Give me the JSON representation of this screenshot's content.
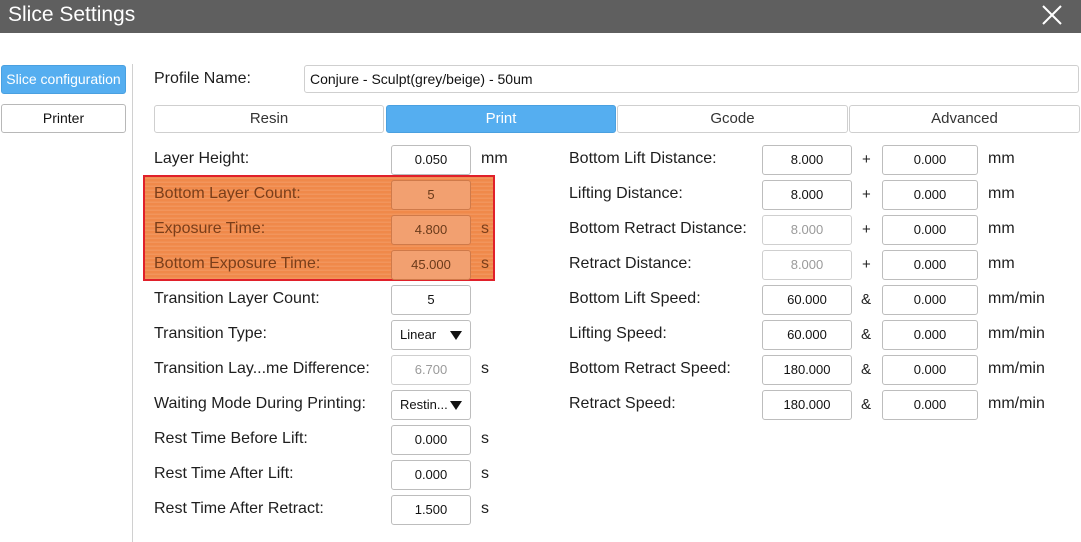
{
  "window": {
    "title": "Slice Settings"
  },
  "sidebar": {
    "items": [
      {
        "label": "Slice configuration"
      },
      {
        "label": "Printer"
      }
    ]
  },
  "profile": {
    "label": "Profile Name:",
    "value": "Conjure - Sculpt(grey/beige) - 50um"
  },
  "tabs": [
    {
      "label": "Resin"
    },
    {
      "label": "Print"
    },
    {
      "label": "Gcode"
    },
    {
      "label": "Advanced"
    }
  ],
  "left_settings": [
    {
      "label": "Layer Height:",
      "value": "0.050",
      "unit": "mm"
    },
    {
      "label": "Bottom Layer Count:",
      "value": "5",
      "unit": ""
    },
    {
      "label": "Exposure Time:",
      "value": "4.800",
      "unit": "s"
    },
    {
      "label": "Bottom Exposure Time:",
      "value": "45.000",
      "unit": "s"
    },
    {
      "label": "Transition Layer Count:",
      "value": "5",
      "unit": ""
    },
    {
      "label": "Transition Type:",
      "value": "Linear",
      "unit": ""
    },
    {
      "label": "Transition Lay...me Difference:",
      "value": "6.700",
      "unit": "s"
    },
    {
      "label": "Waiting Mode During Printing:",
      "value": "Restin...",
      "unit": ""
    },
    {
      "label": "Rest Time Before Lift:",
      "value": "0.000",
      "unit": "s"
    },
    {
      "label": "Rest Time After Lift:",
      "value": "0.000",
      "unit": "s"
    },
    {
      "label": "Rest Time After Retract:",
      "value": "1.500",
      "unit": "s"
    }
  ],
  "right_settings": [
    {
      "label": "Bottom Lift Distance:",
      "value": "8.000",
      "op": "+",
      "value2": "0.000",
      "unit": "mm"
    },
    {
      "label": "Lifting Distance:",
      "value": "8.000",
      "op": "+",
      "value2": "0.000",
      "unit": "mm"
    },
    {
      "label": "Bottom Retract Distance:",
      "value": "8.000",
      "op": "+",
      "value2": "0.000",
      "unit": "mm"
    },
    {
      "label": "Retract Distance:",
      "value": "8.000",
      "op": "+",
      "value2": "0.000",
      "unit": "mm"
    },
    {
      "label": "Bottom Lift Speed:",
      "value": "60.000",
      "op": "&",
      "value2": "0.000",
      "unit": "mm/min"
    },
    {
      "label": "Lifting Speed:",
      "value": "60.000",
      "op": "&",
      "value2": "0.000",
      "unit": "mm/min"
    },
    {
      "label": "Bottom Retract Speed:",
      "value": "180.000",
      "op": "&",
      "value2": "0.000",
      "unit": "mm/min"
    },
    {
      "label": "Retract Speed:",
      "value": "180.000",
      "op": "&",
      "value2": "0.000",
      "unit": "mm/min"
    }
  ],
  "icons": {
    "close": "close-icon",
    "dropdown": "triangle-down-icon"
  },
  "colors": {
    "titlebar": "#5f5f5f",
    "accent": "#55aef0",
    "highlight_border": "#e0202a",
    "highlight_fill": "#f0894a"
  }
}
